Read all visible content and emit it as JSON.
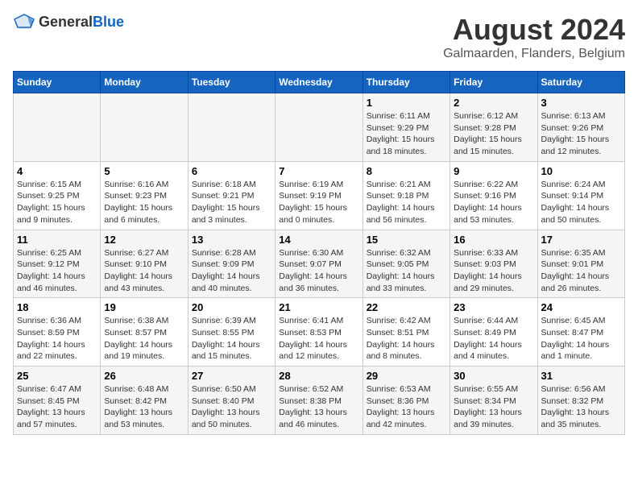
{
  "header": {
    "logo_general": "General",
    "logo_blue": "Blue",
    "title": "August 2024",
    "subtitle": "Galmaarden, Flanders, Belgium"
  },
  "calendar": {
    "days_of_week": [
      "Sunday",
      "Monday",
      "Tuesday",
      "Wednesday",
      "Thursday",
      "Friday",
      "Saturday"
    ],
    "weeks": [
      [
        {
          "day": "",
          "info": ""
        },
        {
          "day": "",
          "info": ""
        },
        {
          "day": "",
          "info": ""
        },
        {
          "day": "",
          "info": ""
        },
        {
          "day": "1",
          "info": "Sunrise: 6:11 AM\nSunset: 9:29 PM\nDaylight: 15 hours and 18 minutes."
        },
        {
          "day": "2",
          "info": "Sunrise: 6:12 AM\nSunset: 9:28 PM\nDaylight: 15 hours and 15 minutes."
        },
        {
          "day": "3",
          "info": "Sunrise: 6:13 AM\nSunset: 9:26 PM\nDaylight: 15 hours and 12 minutes."
        }
      ],
      [
        {
          "day": "4",
          "info": "Sunrise: 6:15 AM\nSunset: 9:25 PM\nDaylight: 15 hours and 9 minutes."
        },
        {
          "day": "5",
          "info": "Sunrise: 6:16 AM\nSunset: 9:23 PM\nDaylight: 15 hours and 6 minutes."
        },
        {
          "day": "6",
          "info": "Sunrise: 6:18 AM\nSunset: 9:21 PM\nDaylight: 15 hours and 3 minutes."
        },
        {
          "day": "7",
          "info": "Sunrise: 6:19 AM\nSunset: 9:19 PM\nDaylight: 15 hours and 0 minutes."
        },
        {
          "day": "8",
          "info": "Sunrise: 6:21 AM\nSunset: 9:18 PM\nDaylight: 14 hours and 56 minutes."
        },
        {
          "day": "9",
          "info": "Sunrise: 6:22 AM\nSunset: 9:16 PM\nDaylight: 14 hours and 53 minutes."
        },
        {
          "day": "10",
          "info": "Sunrise: 6:24 AM\nSunset: 9:14 PM\nDaylight: 14 hours and 50 minutes."
        }
      ],
      [
        {
          "day": "11",
          "info": "Sunrise: 6:25 AM\nSunset: 9:12 PM\nDaylight: 14 hours and 46 minutes."
        },
        {
          "day": "12",
          "info": "Sunrise: 6:27 AM\nSunset: 9:10 PM\nDaylight: 14 hours and 43 minutes."
        },
        {
          "day": "13",
          "info": "Sunrise: 6:28 AM\nSunset: 9:09 PM\nDaylight: 14 hours and 40 minutes."
        },
        {
          "day": "14",
          "info": "Sunrise: 6:30 AM\nSunset: 9:07 PM\nDaylight: 14 hours and 36 minutes."
        },
        {
          "day": "15",
          "info": "Sunrise: 6:32 AM\nSunset: 9:05 PM\nDaylight: 14 hours and 33 minutes."
        },
        {
          "day": "16",
          "info": "Sunrise: 6:33 AM\nSunset: 9:03 PM\nDaylight: 14 hours and 29 minutes."
        },
        {
          "day": "17",
          "info": "Sunrise: 6:35 AM\nSunset: 9:01 PM\nDaylight: 14 hours and 26 minutes."
        }
      ],
      [
        {
          "day": "18",
          "info": "Sunrise: 6:36 AM\nSunset: 8:59 PM\nDaylight: 14 hours and 22 minutes."
        },
        {
          "day": "19",
          "info": "Sunrise: 6:38 AM\nSunset: 8:57 PM\nDaylight: 14 hours and 19 minutes."
        },
        {
          "day": "20",
          "info": "Sunrise: 6:39 AM\nSunset: 8:55 PM\nDaylight: 14 hours and 15 minutes."
        },
        {
          "day": "21",
          "info": "Sunrise: 6:41 AM\nSunset: 8:53 PM\nDaylight: 14 hours and 12 minutes."
        },
        {
          "day": "22",
          "info": "Sunrise: 6:42 AM\nSunset: 8:51 PM\nDaylight: 14 hours and 8 minutes."
        },
        {
          "day": "23",
          "info": "Sunrise: 6:44 AM\nSunset: 8:49 PM\nDaylight: 14 hours and 4 minutes."
        },
        {
          "day": "24",
          "info": "Sunrise: 6:45 AM\nSunset: 8:47 PM\nDaylight: 14 hours and 1 minute."
        }
      ],
      [
        {
          "day": "25",
          "info": "Sunrise: 6:47 AM\nSunset: 8:45 PM\nDaylight: 13 hours and 57 minutes."
        },
        {
          "day": "26",
          "info": "Sunrise: 6:48 AM\nSunset: 8:42 PM\nDaylight: 13 hours and 53 minutes."
        },
        {
          "day": "27",
          "info": "Sunrise: 6:50 AM\nSunset: 8:40 PM\nDaylight: 13 hours and 50 minutes."
        },
        {
          "day": "28",
          "info": "Sunrise: 6:52 AM\nSunset: 8:38 PM\nDaylight: 13 hours and 46 minutes."
        },
        {
          "day": "29",
          "info": "Sunrise: 6:53 AM\nSunset: 8:36 PM\nDaylight: 13 hours and 42 minutes."
        },
        {
          "day": "30",
          "info": "Sunrise: 6:55 AM\nSunset: 8:34 PM\nDaylight: 13 hours and 39 minutes."
        },
        {
          "day": "31",
          "info": "Sunrise: 6:56 AM\nSunset: 8:32 PM\nDaylight: 13 hours and 35 minutes."
        }
      ]
    ]
  }
}
